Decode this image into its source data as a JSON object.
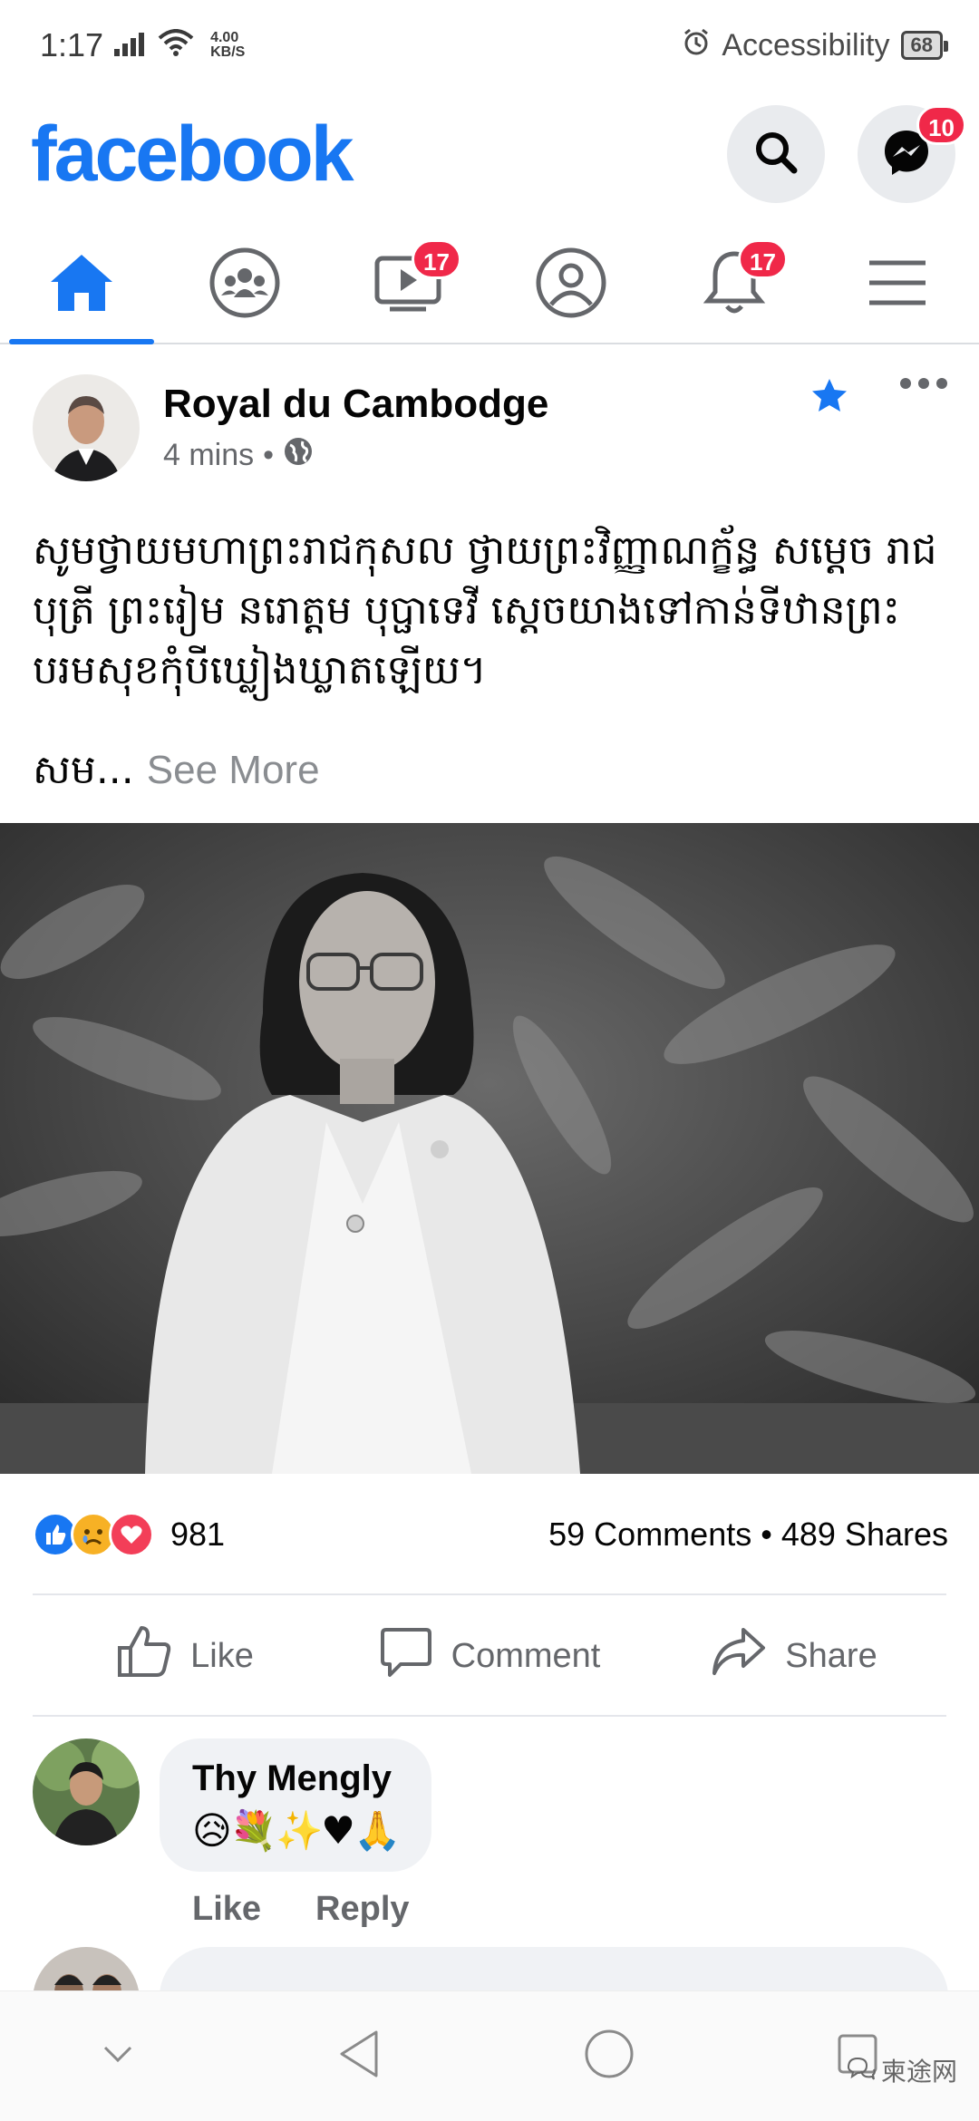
{
  "status_bar": {
    "time": "1:17",
    "net_speed_value": "4.00",
    "net_speed_unit": "KB/S",
    "accessibility_label": "Accessibility",
    "battery": "68"
  },
  "header": {
    "brand": "facebook",
    "messenger_badge": "10"
  },
  "nav": {
    "watch_badge": "17",
    "notifications_badge": "17"
  },
  "post": {
    "author": "Royal du Cambodge",
    "time": "4 mins",
    "separator": "•",
    "text": "សូមថ្វាយមហាព្រះរាជកុសល ថ្វាយព្រះវិញ្ញាណក្ខ័ន្ធ សម្តេច រាជបុត្រី ព្រះរៀម នរោត្តម បុប្ផាទេវី ស្តេចយាងទៅកាន់ទីឋានព្រះបរមសុខកុំបីឃ្លៀងឃ្លាតឡើយ។",
    "truncated_start": "សម...",
    "see_more": "See More",
    "reactions_count": "981",
    "comments": "59 Comments",
    "shares_separator": "•",
    "shares": "489 Shares"
  },
  "actions": {
    "like": "Like",
    "comment": "Comment",
    "share": "Share"
  },
  "comment": {
    "author": "Thy Mengly",
    "text": "😥💐✨♥🙏",
    "like": "Like",
    "reply": "Reply"
  },
  "watermark": {
    "text": "柬途网"
  },
  "colors": {
    "brand": "#1877f2",
    "badge": "#f02849",
    "secondary_text": "#65676b"
  }
}
